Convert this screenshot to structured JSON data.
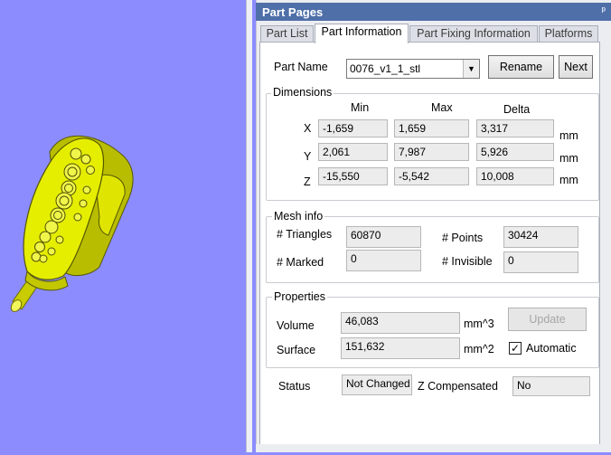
{
  "panel": {
    "title": "Part Pages",
    "pin": "ᵖ"
  },
  "tabs": [
    "Part List",
    "Part Information",
    "Part Fixing Information",
    "Platforms"
  ],
  "part": {
    "name_label": "Part Name",
    "name_value": "0076_v1_1_stl",
    "rename": "Rename",
    "next": "Next"
  },
  "dimensions": {
    "title": "Dimensions",
    "headers": {
      "min": "Min",
      "max": "Max",
      "delta": "Delta"
    },
    "rows": [
      {
        "axis": "X",
        "min": "-1,659",
        "max": "1,659",
        "delta": "3,317",
        "unit": "mm"
      },
      {
        "axis": "Y",
        "min": "2,061",
        "max": "7,987",
        "delta": "5,926",
        "unit": "mm"
      },
      {
        "axis": "Z",
        "min": "-15,550",
        "max": "-5,542",
        "delta": "10,008",
        "unit": "mm"
      }
    ]
  },
  "mesh": {
    "title": "Mesh info",
    "triangles_label": "# Triangles",
    "triangles": "60870",
    "points_label": "# Points",
    "points": "30424",
    "marked_label": "# Marked",
    "marked": "0",
    "invisible_label": "# Invisible",
    "invisible": "0"
  },
  "properties": {
    "title": "Properties",
    "volume_label": "Volume",
    "volume": "46,083",
    "volume_unit": "mm^3",
    "surface_label": "Surface",
    "surface": "151,632",
    "surface_unit": "mm^2",
    "update": "Update",
    "automatic": "Automatic",
    "check": "✓"
  },
  "status": {
    "status_label": "Status",
    "status_value": "Not Changed",
    "zcomp_label": "Z Compensated",
    "zcomp_value": "No"
  },
  "colors": {
    "viewport_bg": "#8c8cff",
    "model_fill": "#e6ee00",
    "titlebar": "#4f6fa8"
  }
}
